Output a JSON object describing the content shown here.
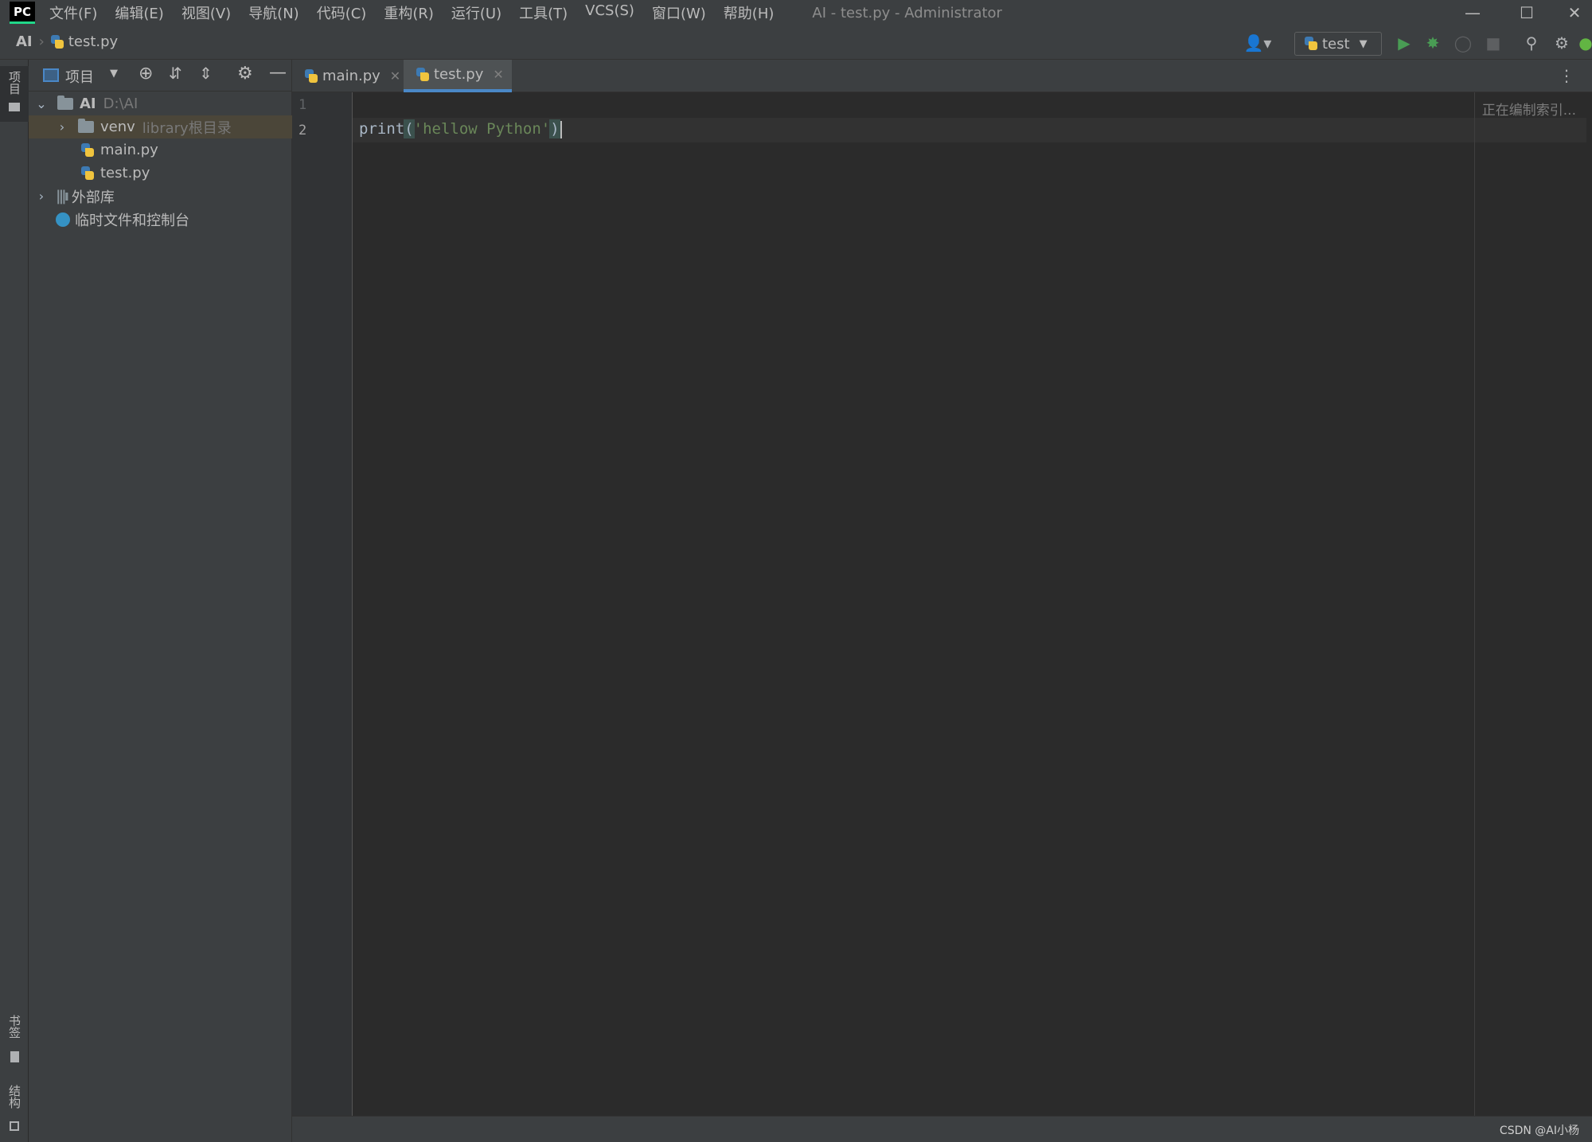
{
  "app": {
    "logo_text": "PC",
    "window_title": "AI - test.py - Administrator",
    "menu": [
      "文件(F)",
      "编辑(E)",
      "视图(V)",
      "导航(N)",
      "代码(C)",
      "重构(R)",
      "运行(U)",
      "工具(T)",
      "VCS(S)",
      "窗口(W)",
      "帮助(H)"
    ]
  },
  "breadcrumb": {
    "project": "AI",
    "file": "test.py"
  },
  "toolbar": {
    "run_config": "test"
  },
  "left_strip": {
    "project_label": "项目",
    "bookmarks_label": "书签",
    "structure_label": "结构"
  },
  "project_panel": {
    "title": "项目",
    "tree": {
      "root_name": "AI",
      "root_path": "D:\\AI",
      "venv_name": "venv",
      "venv_note": "library根目录",
      "file1": "main.py",
      "file2": "test.py",
      "external_libs": "外部库",
      "scratches": "临时文件和控制台"
    }
  },
  "tabs": [
    {
      "label": "main.py"
    },
    {
      "label": "test.py"
    }
  ],
  "editor": {
    "line_numbers": [
      "1",
      "2"
    ],
    "code": {
      "func": "print",
      "open": "(",
      "string": "'hellow Python'",
      "close": ")"
    },
    "indexing_status": "正在编制索引..."
  },
  "watermark": "CSDN @AI小杨",
  "colors": {
    "background": "#2b2b2b",
    "panel": "#3c3f41",
    "accent": "#4a88c7",
    "run_green": "#499c54",
    "string_green": "#6a8759"
  }
}
